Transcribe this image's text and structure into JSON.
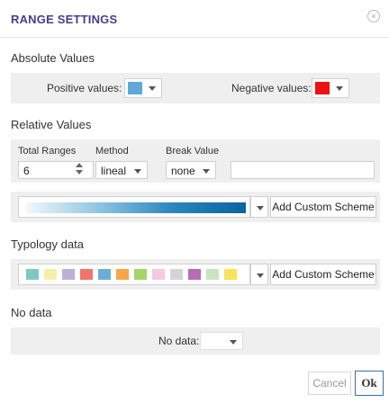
{
  "dialog": {
    "title": "RANGE SETTINGS",
    "close_glyph": "×"
  },
  "absolute": {
    "heading": "Absolute Values",
    "positive_label": "Positive values:",
    "positive_color": "#5fa9d6",
    "negative_label": "Negative values:",
    "negative_color": "#ee1111"
  },
  "relative": {
    "heading": "Relative Values",
    "total_ranges_label": "Total Ranges",
    "method_label": "Method",
    "break_value_label": "Break Value",
    "total_ranges_value": "6",
    "method_value": "lineal",
    "break_value": "none",
    "extra_value": "",
    "gradient_colors": [
      "#f2f8fc",
      "#8fc4e1",
      "#2a85be",
      "#0a64a0"
    ],
    "add_custom_scheme": "Add Custom Scheme"
  },
  "typology": {
    "heading": "Typology data",
    "swatches": [
      "#7dc9c0",
      "#f5f0a8",
      "#b9b1d9",
      "#f2746a",
      "#6aaed6",
      "#f5a64a",
      "#a6d468",
      "#f5c9e0",
      "#d4d4d4",
      "#b66db5",
      "#c7e6c0",
      "#f8e35a"
    ],
    "add_custom_scheme": "Add Custom Scheme"
  },
  "nodata": {
    "heading": "No data",
    "label": "No data:"
  },
  "footer": {
    "cancel": "Cancel",
    "ok": "Ok"
  }
}
